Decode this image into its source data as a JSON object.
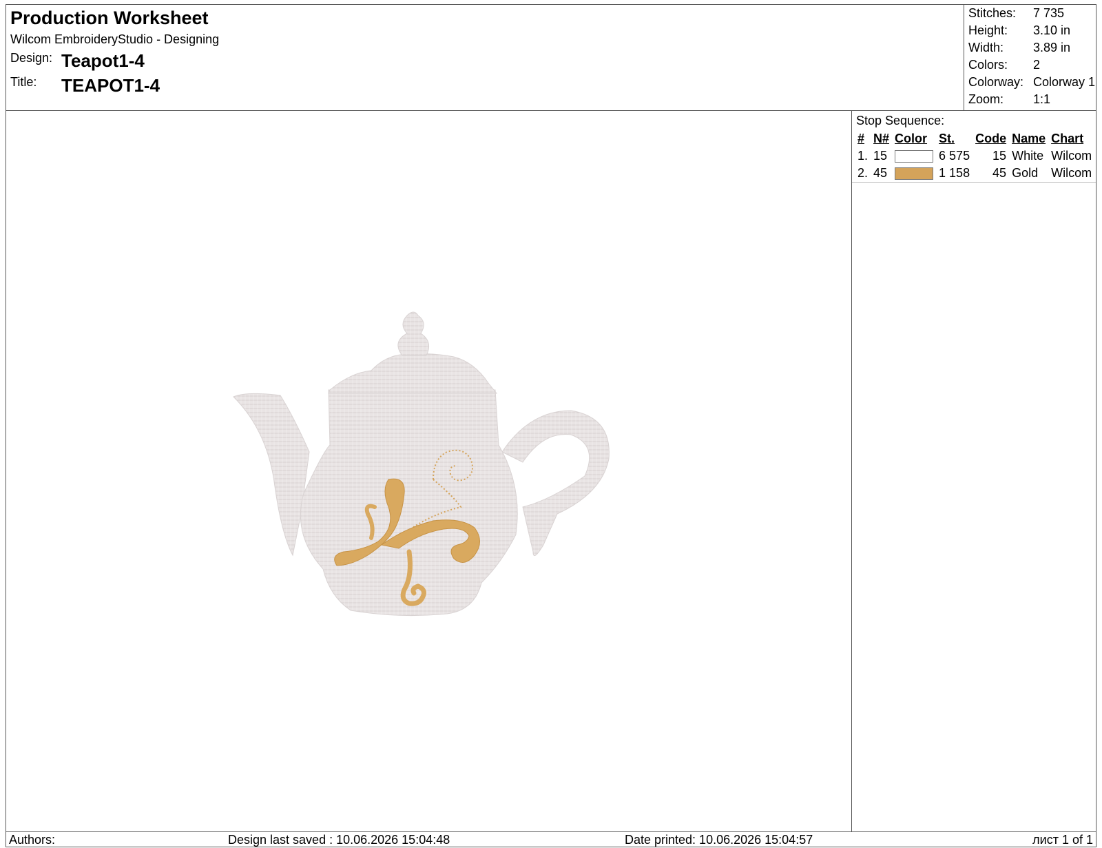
{
  "header": {
    "title": "Production Worksheet",
    "app": "Wilcom EmbroideryStudio - Designing",
    "design_label": "Design:",
    "design_value": "Teapot1-4",
    "title_label": "Title:",
    "title_value": "TEAPOT1-4"
  },
  "stats": [
    {
      "label": "Stitches:",
      "value": "7 735"
    },
    {
      "label": "Height:",
      "value": "3.10 in"
    },
    {
      "label": "Width:",
      "value": "3.89 in"
    },
    {
      "label": "Colors:",
      "value": "2"
    },
    {
      "label": "Colorway:",
      "value": "Colorway 1"
    },
    {
      "label": "Zoom:",
      "value": "1:1"
    }
  ],
  "stop_sequence": {
    "title": "Stop Sequence:",
    "headers": [
      "#",
      "N#",
      "Color",
      "St.",
      "Code",
      "Name",
      "Chart"
    ],
    "rows": [
      {
        "index": "1.",
        "n": "15",
        "color": "#ffffff",
        "stitches": "6 575",
        "code": "15",
        "name": "White",
        "chart": "Wilcom"
      },
      {
        "index": "2.",
        "n": "45",
        "color": "#d4a35a",
        "stitches": "1 158",
        "code": "45",
        "name": "Gold",
        "chart": "Wilcom"
      }
    ]
  },
  "footer": {
    "authors": "Authors:",
    "saved": "Design last saved : 10.06.2026 15:04:48",
    "printed": "Date printed: 10.06.2026 15:04:57",
    "page": "лист 1 of 1"
  }
}
